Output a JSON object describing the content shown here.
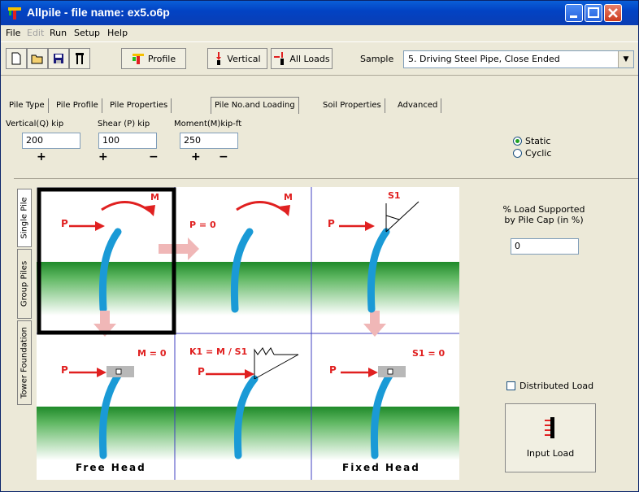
{
  "window": {
    "title": "Allpile - file name: ex5.o6p"
  },
  "menu": [
    "File",
    "Edit",
    "Run",
    "Setup",
    "Help"
  ],
  "toolbar": {
    "profile_label": "Profile",
    "vertical_label": "Vertical",
    "all_loads_label": "All Loads",
    "sample_label": "Sample",
    "sample_value": "5.  Driving Steel Pipe, Close Ended"
  },
  "tabs": [
    "Pile Type",
    "Pile Profile",
    "Pile Properties",
    "Pile No.and Loading",
    "Soil Properties",
    "Advanced"
  ],
  "loads": {
    "vertical_label": "Vertical(Q) kip",
    "vertical_value": "200",
    "shear_label": "Shear (P) kip",
    "shear_value": "100",
    "moment_label": "Moment(M)kip-ft",
    "moment_value": "250",
    "plus": "+",
    "minus": "−"
  },
  "analysis": {
    "static_label": "Static",
    "cyclic_label": "Cyclic",
    "selected": "Static"
  },
  "side_tabs": [
    "Single Pile",
    "Group Piles",
    "Tower Foundation"
  ],
  "diagram": {
    "p": "P",
    "m": "M",
    "p0": "P = 0",
    "s1": "S1",
    "m0": "M = 0",
    "k1": "K1 = M / S1",
    "s10": "S1 = 0",
    "free_head": "Free Head",
    "fixed_head": "Fixed Head"
  },
  "cap": {
    "label_line1": "% Load Supported",
    "label_line2": "by Pile Cap (in %)",
    "value": "0"
  },
  "distributed_load_label": "Distributed Load",
  "input_load_label": "Input Load"
}
